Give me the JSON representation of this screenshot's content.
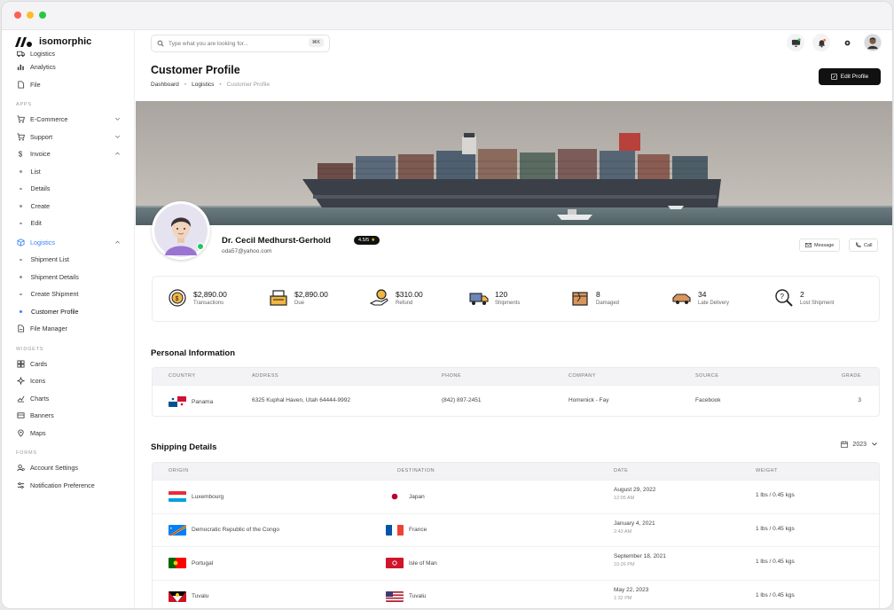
{
  "app": {
    "name": "isomorphic"
  },
  "sidebar": {
    "top_items": [
      {
        "label": "Logistics",
        "icon": "truck-icon"
      },
      {
        "label": "Analytics",
        "icon": "chart-icon"
      },
      {
        "label": "File",
        "icon": "file-icon"
      }
    ],
    "apps_header": "APPS",
    "apps_items": [
      {
        "label": "E-Commerce",
        "icon": "cart-icon"
      },
      {
        "label": "Support",
        "icon": "cart-icon"
      },
      {
        "label": "Invoice",
        "icon": "dollar-icon"
      }
    ],
    "invoice_sub": [
      "List",
      "Details",
      "Create",
      "Edit"
    ],
    "logistics_label": "Logistics",
    "logistics_sub": [
      "Shipment List",
      "Shipment Details",
      "Create Shipment",
      "Customer Profile"
    ],
    "file_manager": "File Manager",
    "widgets_header": "WIDGETS",
    "widgets_items": [
      "Cards",
      "Icons",
      "Charts",
      "Banners",
      "Maps"
    ],
    "forms_header": "FORMS",
    "forms_items": [
      "Account Settings",
      "Notification Preference"
    ]
  },
  "search": {
    "placeholder": "Type what you are looking for...",
    "shortcut": "⌘K"
  },
  "page": {
    "title": "Customer Profile",
    "breadcrumb": [
      "Dashboard",
      "Logistics",
      "Customer Profile"
    ],
    "edit_label": "Edit Profile"
  },
  "profile": {
    "name": "Dr. Cecil Medhurst-Gerhold",
    "rating": "4.5/5",
    "email": "oda57@yahoo.com",
    "message_label": "Message",
    "call_label": "Call"
  },
  "stats": [
    {
      "value": "$2,890.00",
      "label": "Transactions"
    },
    {
      "value": "$2,890.00",
      "label": "Due"
    },
    {
      "value": "$310.00",
      "label": "Refund"
    },
    {
      "value": "120",
      "label": "Shipments"
    },
    {
      "value": "8",
      "label": "Damaged"
    },
    {
      "value": "34",
      "label": "Late Delivery"
    },
    {
      "value": "2",
      "label": "Lost Shipment"
    }
  ],
  "personal": {
    "title": "Personal Information",
    "headers": [
      "COUNTRY",
      "ADDRESS",
      "PHONE",
      "COMPANY",
      "SOURCE",
      "GRADE"
    ],
    "row": {
      "country": "Panama",
      "address": "6325 Kuphal Haven, Utah 64444-9992",
      "phone": "(842) 897-2451",
      "company": "Homenick - Fay",
      "source": "Facebook",
      "grade": "3"
    }
  },
  "shipping": {
    "title": "Shipping Details",
    "year": "2023",
    "headers": [
      "ORIGIN",
      "DESTINATION",
      "DATE",
      "WEIGHT"
    ],
    "rows": [
      {
        "origin": "Luxembourg",
        "destination": "Japan",
        "date": "August 29, 2022",
        "time": "12:05 AM",
        "weight": "1 lbs / 0.45 kgs"
      },
      {
        "origin": "Democratic Republic of the Congo",
        "destination": "France",
        "date": "January 4, 2021",
        "time": "2:43 AM",
        "weight": "1 lbs / 0.45 kgs"
      },
      {
        "origin": "Portugal",
        "destination": "Isle of Man",
        "date": "September 18, 2021",
        "time": "10:26 PM",
        "weight": "1 lbs / 0.45 kgs"
      },
      {
        "origin": "Tuvalu",
        "destination": "Tuvalu",
        "date": "May 22, 2023",
        "time": "1:32 PM",
        "weight": "1 lbs / 0.45 kgs"
      }
    ]
  },
  "colors": {
    "accent": "#3b82f6",
    "dark": "#111111",
    "online": "#22c55e"
  }
}
